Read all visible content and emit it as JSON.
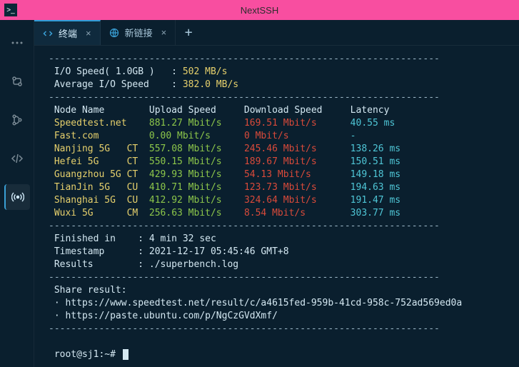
{
  "window": {
    "title": "NextSSH"
  },
  "tabs": {
    "active": {
      "label": "终端"
    },
    "other": {
      "label": "新链接"
    }
  },
  "terminal": {
    "dash": "----------------------------------------------------------------------",
    "io_label": " I/O Speed( 1.0GB )   : ",
    "io_value": "502 MB/s",
    "avg_label": " Average I/O Speed    : ",
    "avg_value": "382.0 MB/s",
    "header": " Node Name        Upload Speed     Download Speed     Latency",
    "rows": [
      {
        "node": " Speedtest.net    ",
        "up": "881.27 Mbit/s    ",
        "dn": "169.51 Mbit/s      ",
        "lat": "40.55 ms"
      },
      {
        "node": " Fast.com         ",
        "up": "0.00 Mbit/s      ",
        "dn": "0 Mbit/s           ",
        "lat": "-"
      },
      {
        "node": " Nanjing 5G   CT  ",
        "up": "557.08 Mbit/s    ",
        "dn": "245.46 Mbit/s      ",
        "lat": "138.26 ms"
      },
      {
        "node": " Hefei 5G     CT  ",
        "up": "550.15 Mbit/s    ",
        "dn": "189.67 Mbit/s      ",
        "lat": "150.51 ms"
      },
      {
        "node": " Guangzhou 5G CT  ",
        "up": "429.93 Mbit/s    ",
        "dn": "54.13 Mbit/s       ",
        "lat": "149.18 ms"
      },
      {
        "node": " TianJin 5G   CU  ",
        "up": "410.71 Mbit/s    ",
        "dn": "123.73 Mbit/s      ",
        "lat": "194.63 ms"
      },
      {
        "node": " Shanghai 5G  CU  ",
        "up": "412.92 Mbit/s    ",
        "dn": "324.64 Mbit/s      ",
        "lat": "191.47 ms"
      },
      {
        "node": " Wuxi 5G      CM  ",
        "up": "256.63 Mbit/s    ",
        "dn": "8.54 Mbit/s        ",
        "lat": "303.77 ms"
      }
    ],
    "finished": " Finished in    : 4 min 32 sec",
    "timestamp": " Timestamp      : 2021-12-17 05:45:46 GMT+8",
    "results": " Results        : ./superbench.log",
    "share_header": " Share result:",
    "share1": " · https://www.speedtest.net/result/c/a4615fed-959b-41cd-958c-752ad569ed0a",
    "share2": " · https://paste.ubuntu.com/p/NgCzGVdXmf/",
    "prompt": " root@sj1:~# "
  }
}
